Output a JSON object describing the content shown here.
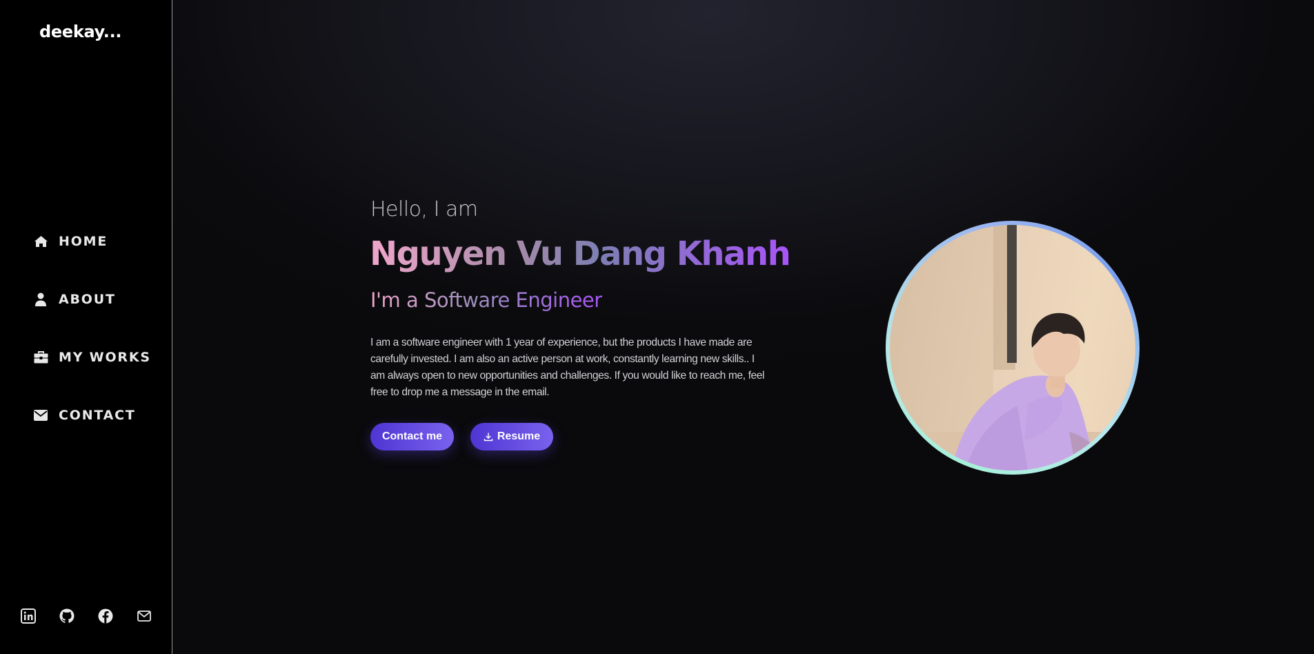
{
  "sidebar": {
    "logo": "deekay...",
    "nav": [
      {
        "label": "HOME",
        "icon": "home-icon"
      },
      {
        "label": "ABOUT",
        "icon": "user-icon"
      },
      {
        "label": "MY WORKS",
        "icon": "briefcase-icon"
      },
      {
        "label": "CONTACT",
        "icon": "envelope-icon"
      }
    ],
    "socials": [
      {
        "icon": "linkedin-icon"
      },
      {
        "icon": "github-icon"
      },
      {
        "icon": "facebook-icon"
      },
      {
        "icon": "mail-icon"
      }
    ]
  },
  "hero": {
    "greeting": "Hello, I am",
    "name": "Nguyen Vu Dang Khanh",
    "role": "I'm a Software Engineer",
    "bio": "I am a software engineer with 1 year of experience, but the products I have made are carefully invested. I am also an active person at work, constantly learning new skills.. I am always open to new opportunities and challenges. If you would like to reach me, feel free to drop me a message in the email.",
    "contact_label": "Contact me",
    "resume_label": "Resume"
  },
  "colors": {
    "accent": "#5b3fe0",
    "gradient_start": "#f0a6cb",
    "gradient_end": "#a855f7",
    "sidebar_bg": "#000000",
    "avatar_ring": "#a6f0d8"
  }
}
